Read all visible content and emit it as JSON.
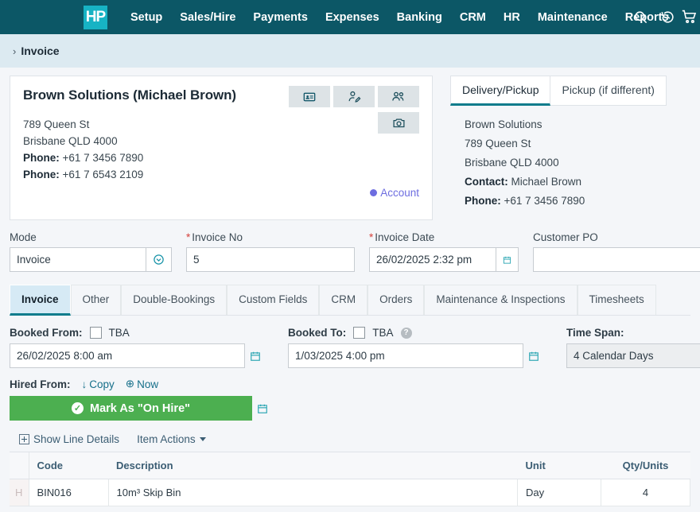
{
  "nav": {
    "logo_text": "HP",
    "items": [
      {
        "label": "Setup"
      },
      {
        "label": "Sales/Hire"
      },
      {
        "label": "Payments"
      },
      {
        "label": "Expenses"
      },
      {
        "label": "Banking"
      },
      {
        "label": "CRM"
      },
      {
        "label": "HR"
      },
      {
        "label": "Maintenance"
      },
      {
        "label": "Reports"
      }
    ],
    "icons": [
      "search-icon",
      "history-icon",
      "cart-icon"
    ]
  },
  "breadcrumb": {
    "chevron": "›",
    "label": "Invoice"
  },
  "customer_card": {
    "title": "Brown Solutions (Michael Brown)",
    "address_line1": "789 Queen St",
    "address_line2": "Brisbane  QLD  4000",
    "phone1_label": "Phone:",
    "phone1_value": "+61 7 3456 7890",
    "phone2_label": "Phone:",
    "phone2_value": "+61 7 6543 2109",
    "account_label": "Account",
    "account_color": "#6d6de0",
    "buttons": [
      "contact-card-icon",
      "person-edit-icon",
      "people-icon",
      "camera-icon"
    ]
  },
  "delivery": {
    "tabs": [
      {
        "label": "Delivery/Pickup",
        "active": true
      },
      {
        "label": "Pickup (if different)",
        "active": false
      }
    ],
    "company": "Brown Solutions",
    "address_line1": "789 Queen St",
    "address_line2": "Brisbane QLD 4000",
    "contact_label": "Contact:",
    "contact_value": "Michael Brown",
    "phone_label": "Phone:",
    "phone_value": "+61 7 3456 7890"
  },
  "fields": {
    "mode": {
      "label": "Mode",
      "value": "Invoice",
      "required": false
    },
    "invoice_no": {
      "label": "Invoice No",
      "value": "5",
      "required": true,
      "required_mark": "*"
    },
    "invoice_date": {
      "label": "Invoice Date",
      "value": "26/02/2025 2:32 pm",
      "required": true,
      "required_mark": "*"
    },
    "customer_po": {
      "label": "Customer PO",
      "value": "",
      "required": false
    }
  },
  "main_tabs": [
    {
      "label": "Invoice",
      "active": true
    },
    {
      "label": "Other",
      "active": false
    },
    {
      "label": "Double-Bookings",
      "active": false
    },
    {
      "label": "Custom Fields",
      "active": false
    },
    {
      "label": "CRM",
      "active": false
    },
    {
      "label": "Orders",
      "active": false
    },
    {
      "label": "Maintenance & Inspections",
      "active": false
    },
    {
      "label": "Timesheets",
      "active": false
    }
  ],
  "booking": {
    "booked_from": {
      "label": "Booked From:",
      "tba_label": "TBA",
      "tba_checked": false,
      "value": "26/02/2025 8:00 am"
    },
    "booked_to": {
      "label": "Booked To:",
      "tba_label": "TBA",
      "tba_checked": false,
      "value": "1/03/2025 4:00 pm",
      "help": "?"
    },
    "time_span": {
      "label": "Time Span:",
      "value": "4 Calendar Days",
      "disabled": true
    }
  },
  "hire": {
    "label": "Hired From:",
    "copy_label": "Copy",
    "copy_icon": "↓",
    "now_label": "Now",
    "now_icon": "⊕",
    "button_label": "Mark As \"On Hire\"",
    "button_color": "#4caf50",
    "button_check": "✓"
  },
  "line_actions": {
    "show_line_details": "Show Line Details",
    "item_actions": "Item Actions"
  },
  "line_table": {
    "columns": [
      "",
      "Code",
      "Description",
      "Unit",
      "Qty/Units"
    ],
    "rows": [
      {
        "flag": "H",
        "code": "BIN016",
        "description": "10m³ Skip Bin",
        "unit": "Day",
        "qty": "4"
      }
    ]
  }
}
